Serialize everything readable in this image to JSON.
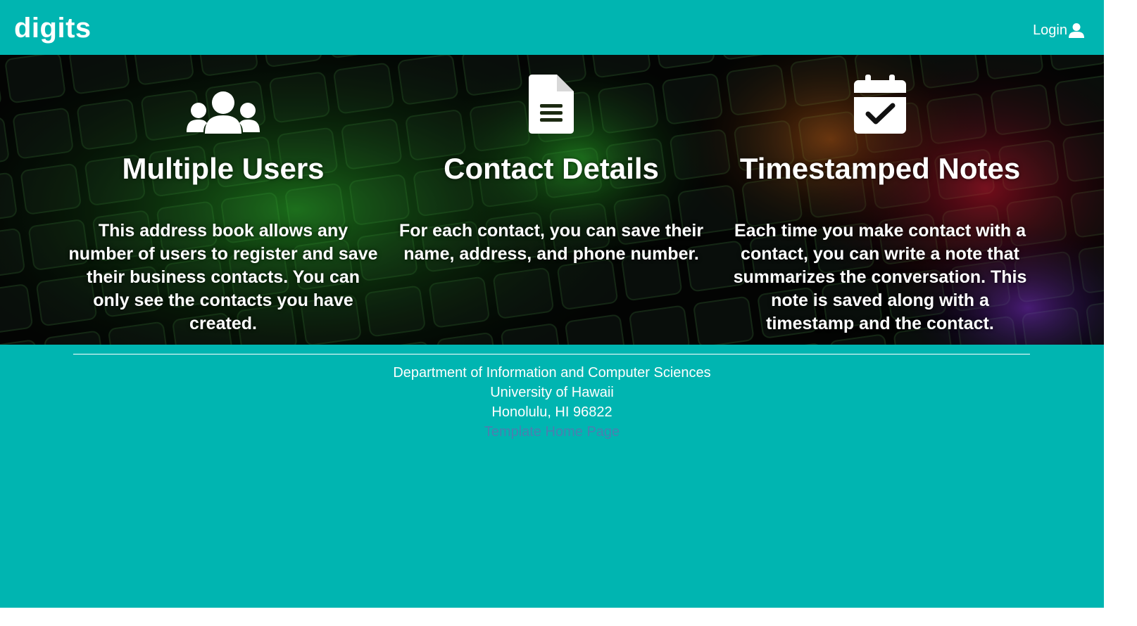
{
  "navbar": {
    "brand": "digits",
    "login_label": "Login",
    "login_icon": "user-icon"
  },
  "features": [
    {
      "icon": "users-icon",
      "title": "Multiple Users",
      "text": "This address book allows any number of users to register and save their business contacts. You can only see the contacts you have created."
    },
    {
      "icon": "file-text-icon",
      "title": "Contact Details",
      "text": "For each contact, you can save their name, address, and phone number."
    },
    {
      "icon": "calendar-check-icon",
      "title": "Timestamped Notes",
      "text": "Each time you make contact with a contact, you can write a note that summarizes the conversation. This note is saved along with a timestamp and the contact."
    }
  ],
  "footer": {
    "department": "Department of Information and Computer Sciences",
    "university": "University of Hawaii",
    "address": "Honolulu, HI 96822",
    "link_label": "Template Home Page"
  },
  "colors": {
    "primary": "#00b5b1",
    "text": "#ffffff",
    "link": "#4a7fb0"
  }
}
